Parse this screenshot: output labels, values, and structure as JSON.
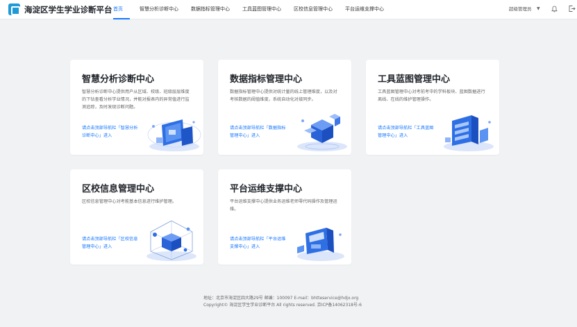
{
  "header": {
    "title": "海淀区学生学业诊断平台",
    "nav": [
      "首页",
      "智慧分析诊断中心",
      "数据指标管理中心",
      "工具蓝图管理中心",
      "区校信息管理中心",
      "平台运维支撑中心"
    ],
    "active_nav": "首页",
    "user": "超级管理员"
  },
  "cards": [
    {
      "title": "智慧分析诊断中心",
      "desc": "智慧分析诊断中心提供用户从区域、校级、班级层层维度的下钻查看分析学业情况，并能对报表内的异常值进行监测追踪，及时发现诊断问题。",
      "link": "请点击顶部导航栏「智慧分析诊断中心」进入"
    },
    {
      "title": "数据指标管理中心",
      "desc": "数据指标管理中心提供对统计量的线上管理维度，以及对考核数据的阈值维度，系统自动化对接同步。",
      "link": "请点击顶部导航栏「数据指标管理中心」进入"
    },
    {
      "title": "工具蓝图管理中心",
      "desc": "工具蓝图管理中心对考前考中的学科板块、蓝图数据进行离线、在线的维护管理操作。",
      "link": "请点击顶部导航栏「工具蓝图管理中心」进入"
    },
    {
      "title": "区校信息管理中心",
      "desc": "区校信息管理中心对考能基本信息进行维护管理。",
      "link": "请点击顶部导航栏「区校信息管理中心」进入"
    },
    {
      "title": "平台运维支撑中心",
      "desc": "平台运维支撑中心提供业务运维老师零代码操作及管理运维。",
      "link": "请点击顶部导航栏「平台运维支撑中心」进入"
    }
  ],
  "footer": {
    "line1": "地址：北京市海淀区四大路29号    邮编：100097    E-mail：bhtteservice@hdjx.org",
    "line2": "Copyright©    海淀区学生学业诊断平台    All rights reserved.    京ICP备14062318号-6"
  },
  "colors": {
    "accent": "#1677ff",
    "logo": "#1f9ad6",
    "background": "#f1f2f4",
    "card": "#ffffff"
  },
  "icons": [
    "logo-icon",
    "caret-down-icon",
    "bell-icon",
    "logout-icon"
  ]
}
